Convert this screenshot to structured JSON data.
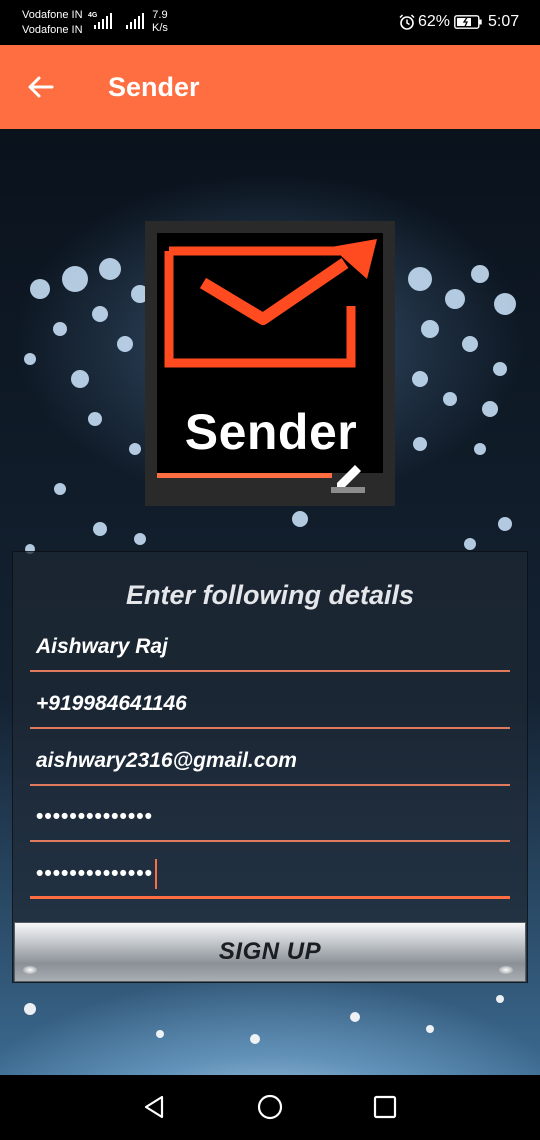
{
  "status_bar": {
    "carrier_1": "Vodafone IN",
    "carrier_2": "Vodafone IN",
    "network_type": "4G",
    "speed_value": "7.9",
    "speed_unit": "K/s",
    "battery_percent": "62%",
    "time": "5:07",
    "icons": [
      "signal-icon",
      "alarm-icon",
      "battery-icon"
    ]
  },
  "app_bar": {
    "title": "Sender",
    "back_icon": "arrow-left-icon",
    "background_color": "#ff6e40"
  },
  "logo": {
    "text": "Sender",
    "icons": [
      "envelope-arrow-icon",
      "pencil-icon"
    ],
    "accent_color": "#ff4b1f"
  },
  "form": {
    "heading": "Enter following details",
    "fields": {
      "name": "Aishwary Raj",
      "phone": "+919984641146",
      "email": "aishwary2316@gmail.com",
      "password": "••••••••••••••",
      "confirm_password": "••••••••••••••"
    },
    "submit_label": "SIGN UP",
    "line_color": "#e07a5f"
  },
  "nav_bar": {
    "icons": [
      "back-triangle-icon",
      "home-circle-icon",
      "recents-square-icon"
    ]
  }
}
